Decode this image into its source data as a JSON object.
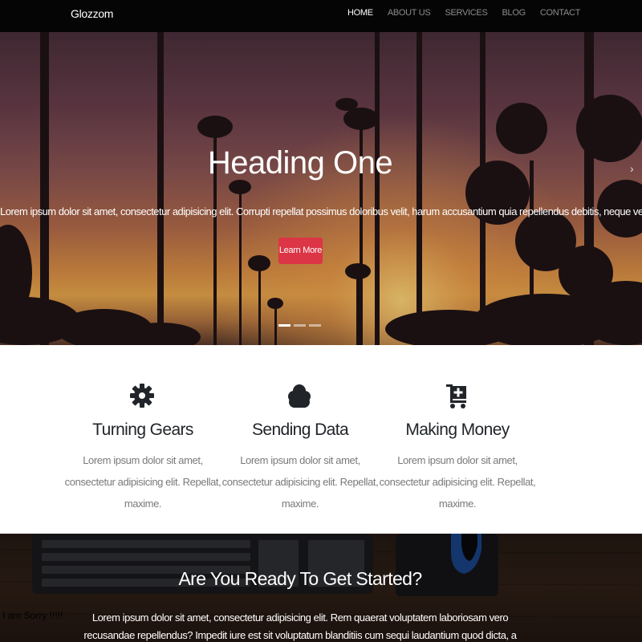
{
  "navbar": {
    "brand": "Glozzom",
    "links": [
      {
        "label": "HOME",
        "active": true
      },
      {
        "label": "ABOUT US"
      },
      {
        "label": "SERVICES"
      },
      {
        "label": "BLOG"
      },
      {
        "label": "CONTACT"
      }
    ]
  },
  "hero": {
    "title": "Heading One",
    "text": "Lorem ipsum dolor sit amet, consectetur adipisicing elit. Corrupti repellat possimus doloribus velit, harum accusantium quia repellendus debitis, neque vero.",
    "button_label": "Learn More",
    "slide_count": 3,
    "active_slide": 1,
    "next_icon": "chevron-right-icon"
  },
  "features": [
    {
      "icon": "gear-icon",
      "title": "Turning Gears",
      "text": "Lorem ipsum dolor sit amet, consectetur adipisicing elit. Repellat, maxime."
    },
    {
      "icon": "cloud-icon",
      "title": "Sending Data",
      "text": "Lorem ipsum dolor sit amet, consectetur adipisicing elit. Repellat, maxime."
    },
    {
      "icon": "cart-plus-icon",
      "title": "Making Money",
      "text": "Lorem ipsum dolor sit amet, consectetur adipisicing elit. Repellat, maxime."
    }
  ],
  "cta": {
    "title": "Are You Ready To Get Started?",
    "text": "Lorem ipsum dolor sit amet, consectetur adipisicing elit. Rem quaerat voluptatem laboriosam vero recusandae repellendus? Impedit iure est sit voluptatum blanditiis cum sequi laudantium quod dicta, a quaerat vel, obcaecati!",
    "overlay_note": "I am Sorry !!!!!"
  },
  "colors": {
    "navbar_bg": "#050505",
    "button_red": "#dc3545",
    "heading_text": "#212529",
    "muted_text": "#7a7a7a"
  }
}
